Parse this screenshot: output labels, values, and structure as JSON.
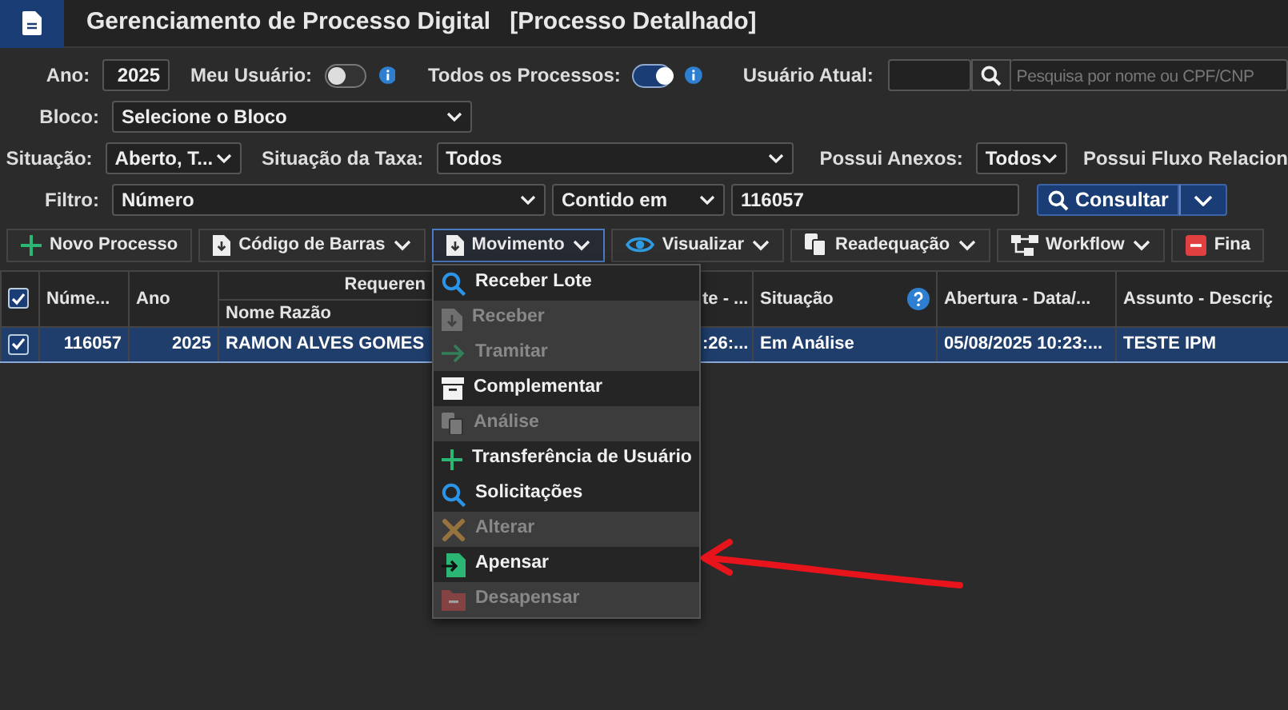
{
  "app": {
    "title": "Gerenciamento de Processo Digital",
    "subtitle": "[Processo Detalhado]"
  },
  "filters": {
    "ano": {
      "label": "Ano:",
      "value": "2025"
    },
    "meu_usuario": {
      "label": "Meu Usuário:",
      "on": false
    },
    "todos_processos": {
      "label": "Todos os Processos:",
      "on": true
    },
    "usuario_atual": {
      "label": "Usuário Atual:",
      "placeholder": "Pesquisa por nome ou CPF/CNP"
    },
    "bloco": {
      "label": "Bloco:",
      "value": "Selecione o Bloco"
    },
    "situacao": {
      "label": "Situação:",
      "value": "Aberto, T..."
    },
    "situacao_taxa": {
      "label": "Situação da Taxa:",
      "value": "Todos"
    },
    "possui_anexos": {
      "label": "Possui Anexos:",
      "value": "Todos"
    },
    "possui_fluxo": {
      "label": "Possui Fluxo Relacion"
    },
    "filtro": {
      "label": "Filtro:",
      "field": "Número",
      "operator": "Contido em",
      "value": "116057"
    },
    "consultar": "Consultar"
  },
  "toolbar": [
    {
      "label": "Novo Processo",
      "kind": "plus",
      "dropdown": false,
      "selected": false
    },
    {
      "label": "Código de Barras",
      "kind": "doc",
      "dropdown": true,
      "selected": false
    },
    {
      "label": "Movimento",
      "kind": "doc",
      "dropdown": true,
      "selected": true
    },
    {
      "label": "Visualizar",
      "kind": "eye",
      "dropdown": true,
      "selected": false
    },
    {
      "label": "Readequação",
      "kind": "copy",
      "dropdown": true,
      "selected": false
    },
    {
      "label": "Workflow",
      "kind": "flow",
      "dropdown": true,
      "selected": false
    },
    {
      "label": "Fina",
      "kind": "minus",
      "dropdown": false,
      "selected": false
    }
  ],
  "table": {
    "all_checked": true,
    "group_header": "Requeren",
    "columns": [
      "Núme...",
      "Ano",
      "Nome Razão",
      "te - ...",
      "Situação",
      "Abertura - Data/...",
      "Assunto - Descriç"
    ],
    "rows": [
      {
        "checked": true,
        "selected": true,
        "cells": [
          "116057",
          "2025",
          "RAMON ALVES GOMES",
          ":26:...",
          "Em Análise",
          "05/08/2025 10:23:...",
          "TESTE IPM"
        ]
      }
    ]
  },
  "menu": [
    {
      "label": "Receber Lote",
      "kind": "search",
      "disabled": false
    },
    {
      "label": "Receber",
      "kind": "download",
      "disabled": true
    },
    {
      "label": "Tramitar",
      "kind": "arrow",
      "disabled": true
    },
    {
      "label": "Complementar",
      "kind": "archive",
      "disabled": false
    },
    {
      "label": "Análise",
      "kind": "copy",
      "disabled": true
    },
    {
      "label": "Transferência de Usuário",
      "kind": "plus",
      "disabled": false
    },
    {
      "label": "Solicitações",
      "kind": "search",
      "disabled": false
    },
    {
      "label": "Alterar",
      "kind": "tools",
      "disabled": true
    },
    {
      "label": "Apensar",
      "kind": "enter",
      "disabled": false
    },
    {
      "label": "Desapensar",
      "kind": "remove",
      "disabled": true
    }
  ]
}
